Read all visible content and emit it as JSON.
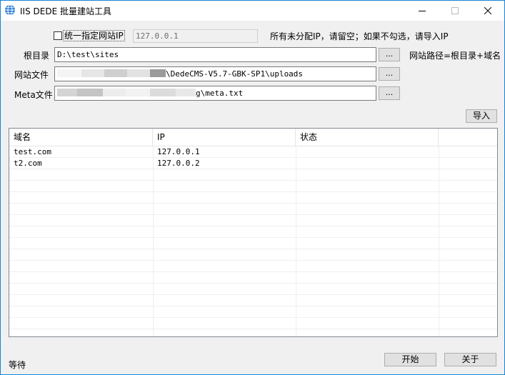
{
  "window": {
    "title": "IIS DEDE 批量建站工具"
  },
  "options": {
    "unify_ip_label": "统一指定网站IP",
    "unify_ip_checked": false,
    "ip_value": "127.0.0.1",
    "ip_hint": "所有未分配IP，请留空；如果不勾选，请导入IP"
  },
  "root_dir": {
    "label": "根目录",
    "value": "D:\\test\\sites",
    "browse": "...",
    "hint": "网站路径=根目录+域名"
  },
  "site_files": {
    "label": "网站文件",
    "value_visible": "\\DedeCMS-V5.7-GBK-SP1\\uploads",
    "browse": "..."
  },
  "meta_file": {
    "label": "Meta文件",
    "value_visible": "g\\meta.txt",
    "browse": "..."
  },
  "import_button": "导入",
  "table": {
    "columns": [
      "域名",
      "IP",
      "状态"
    ],
    "rows": [
      {
        "domain": "test.com",
        "ip": "127.0.0.1",
        "status": ""
      },
      {
        "domain": "t2.com",
        "ip": "127.0.0.2",
        "status": ""
      }
    ]
  },
  "status_text": "等待",
  "buttons": {
    "start": "开始",
    "about": "关于"
  },
  "colors": {
    "accent": "#1883d7",
    "client_bg": "#f0f0f0",
    "button_bg": "#e1e1e1"
  }
}
